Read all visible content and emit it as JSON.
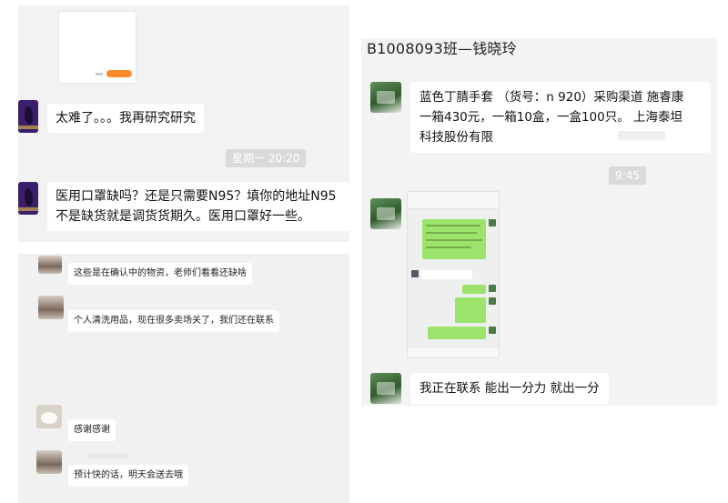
{
  "top_left": {
    "messages": [
      {
        "text": "太难了。。。我再研究研究"
      },
      {
        "text": "医用口罩缺吗？还是只需要N95？填你的地址N95"
      },
      {
        "text": "不是缺货就是调货货期久。医用口罩好一些。"
      }
    ],
    "timestamp": "星期一 20:20"
  },
  "bottom_left": {
    "messages": [
      {
        "text": "这些是在确认中的物资，老师们看看还缺啥"
      },
      {
        "text": "个人清洗用品，现在很多卖场关了，我们还在联系"
      },
      {
        "text": "感谢感谢"
      },
      {
        "text": "预计快的话，明天会送去哦"
      }
    ]
  },
  "right": {
    "title": "B1008093班—钱晓玲",
    "messages": [
      {
        "lines": [
          "蓝色丁腈手套 （货号：n 920）采购渠道 施睿康",
          "一箱430元，一箱10盒，一盒100只。 上海泰坦",
          "科技股份有限"
        ]
      },
      {
        "text": "我正在联系 能出一分力 就出一分"
      }
    ],
    "timestamp": "9:45"
  },
  "colors": {
    "panel_bg": "#f2f2f2",
    "bubble_bg": "#ffffff",
    "time_chip": "#dadada",
    "accent_orange": "#ff8a2a",
    "wechat_green": "#9be36b"
  }
}
